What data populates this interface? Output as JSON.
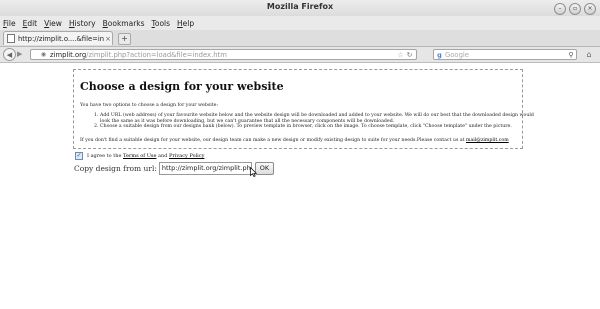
{
  "window": {
    "title": "Mozilla Firefox"
  },
  "menubar": {
    "items": [
      {
        "mnemonic": "F",
        "rest": "ile"
      },
      {
        "mnemonic": "E",
        "rest": "dit"
      },
      {
        "mnemonic": "V",
        "rest": "iew"
      },
      {
        "mnemonic": "H",
        "rest": "istory"
      },
      {
        "mnemonic": "B",
        "rest": "ookmarks"
      },
      {
        "mnemonic": "T",
        "rest": "ools"
      },
      {
        "mnemonic": "H",
        "rest": "elp"
      }
    ]
  },
  "tabs": [
    {
      "label": "http://zimplit.o....&file=index.htm"
    }
  ],
  "navbar": {
    "url_domain": "zimplit.org",
    "url_path": "/zimplit.php?action=load&file=index.htm",
    "search_placeholder": "Google"
  },
  "page": {
    "heading": "Choose a design for your website",
    "intro": "You have two options to choose a design for your website:",
    "options": [
      "Add URL (web address) of your favourite website below and the website design will be downloaded and added to your website. We will do our best that the downloaded design would look the same as it was before downloading, but we can't guarantee that all the necessary components will be downloaded.",
      "Choose a suitable design from our designs bank (below). To preview template in browser, click on the image. To choose template, click \"Choose template\" under the picture."
    ],
    "fallback_text": "If you don't find a suitable design for your website, our design team can make a new design or modify existing design to suite for your needs.Please contact us at",
    "fallback_email": "mail@zimplit.com",
    "agree_prefix": "I agree to the",
    "terms_link": "Terms of Use",
    "agree_and": "and",
    "privacy_link": "Privacy Policy",
    "copy_label": "Copy design from url:",
    "copy_url_value": "http://zimplit.org/zimplit.php",
    "ok_label": "OK",
    "terms_checked": true
  },
  "icons": {
    "back": "back-arrow-icon",
    "forward": "forward-arrow-icon",
    "bookmark": "star-icon",
    "reload": "reload-icon",
    "search": "magnifier-icon",
    "home": "home-icon"
  }
}
